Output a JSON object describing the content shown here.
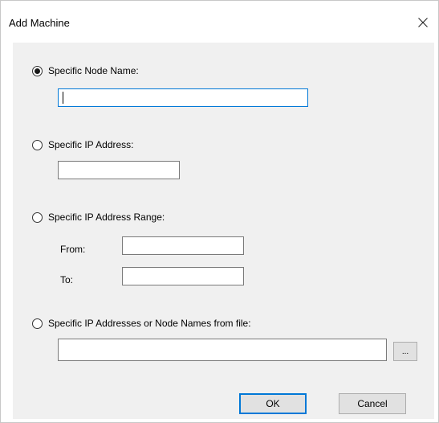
{
  "dialog": {
    "title": "Add Machine",
    "close_icon": "close-icon"
  },
  "options": {
    "node_name": {
      "label": "Specific Node Name:",
      "checked": true,
      "value": ""
    },
    "ip_address": {
      "label": "Specific IP Address:",
      "checked": false,
      "value": ""
    },
    "ip_range": {
      "label": "Specific IP Address Range:",
      "checked": false,
      "from_label": "From:",
      "from_value": "",
      "to_label": "To:",
      "to_value": ""
    },
    "from_file": {
      "label": "Specific IP Addresses or Node Names from file:",
      "checked": false,
      "value": "",
      "browse_label": "..."
    }
  },
  "buttons": {
    "ok_label": "OK",
    "cancel_label": "Cancel"
  },
  "colors": {
    "focus_accent": "#0078d7",
    "panel_background": "#f0f0f0"
  }
}
